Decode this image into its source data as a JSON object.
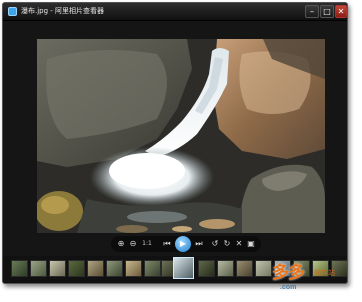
{
  "window": {
    "title": "瀑布.jpg - 阿里相片查看器",
    "buttons": {
      "minimize": "–",
      "maximize": "□",
      "close": "✕"
    }
  },
  "image": {
    "description_icon": "waterfall-photo"
  },
  "toolbar": {
    "zoom_label": "1:1",
    "icons": [
      "zoom-in-icon",
      "zoom-out-icon",
      "actual-size",
      "previous-icon",
      "play-icon",
      "next-icon",
      "rotate-left-icon",
      "rotate-right-icon",
      "delete-icon",
      "save-icon"
    ],
    "glyphs": {
      "zoom_in": "⊕",
      "zoom_out": "⊖",
      "prev": "⏮",
      "play": "▶",
      "next": "⏭",
      "rotate_left": "↺",
      "rotate_right": "↻",
      "delete": "✕",
      "save": "▣"
    }
  },
  "filmstrip": {
    "thumb_count": 20,
    "active_index": 9
  },
  "watermark": {
    "big": "多多",
    "small": "软件站",
    "url": ".com"
  },
  "colors": {
    "window_bg": "#151515",
    "accent_blue": "#1f7fd0",
    "watermark_orange": "#e8751c"
  }
}
